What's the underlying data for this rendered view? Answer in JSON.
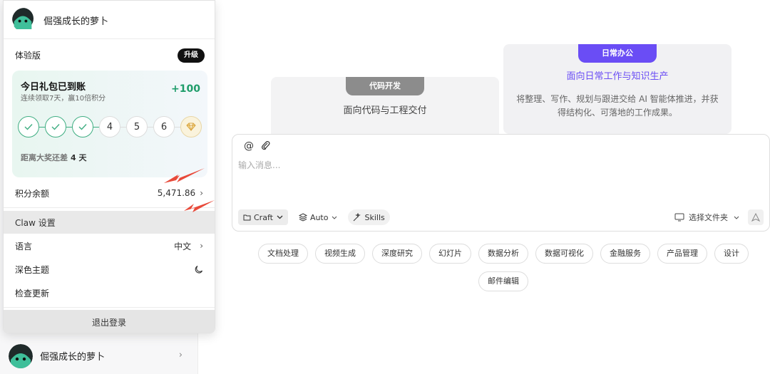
{
  "user": {
    "name": "倔强成长的萝卜"
  },
  "panel": {
    "plan_label": "体验版",
    "upgrade_label": "升级",
    "gift": {
      "title": "今日礼包已到账",
      "subtitle": "连续领取7天，赢10倍积分",
      "bonus": "+100",
      "days": [
        {
          "label": "",
          "state": "done"
        },
        {
          "label": "",
          "state": "done"
        },
        {
          "label": "",
          "state": "done"
        },
        {
          "label": "4",
          "state": "todo"
        },
        {
          "label": "5",
          "state": "todo"
        },
        {
          "label": "6",
          "state": "todo"
        },
        {
          "label": "",
          "state": "prize"
        }
      ],
      "remain_prefix": "距离大奖还差",
      "remain_value": "4 天"
    },
    "points_label": "积分余额",
    "points_value": "5,471.86",
    "claw_settings": "Claw 设置",
    "language_label": "语言",
    "language_value": "中文",
    "dark_theme": "深色主题",
    "check_update": "检查更新",
    "logout": "退出登录"
  },
  "cards": {
    "code": {
      "tag": "代码开发",
      "title": "面向代码与工程交付"
    },
    "office": {
      "tag": "日常办公",
      "title": "面向日常工作与知识生产",
      "desc": "将整理、写作、规划与跟进交给 AI 智能体推进，并获得结构化、可落地的工作成果。"
    }
  },
  "composer": {
    "placeholder": "输入消息...",
    "mode": "Craft",
    "model": "Auto",
    "skills": "Skills",
    "folder": "选择文件夹"
  },
  "categories": [
    "文档处理",
    "视频生成",
    "深度研究",
    "幻灯片",
    "数据分析",
    "数据可视化",
    "金融服务",
    "产品管理",
    "设计",
    "邮件编辑"
  ],
  "colors": {
    "accent_purple": "#6a4df5",
    "success_green": "#1f9d6a",
    "annotation_red": "#e84a3a"
  }
}
